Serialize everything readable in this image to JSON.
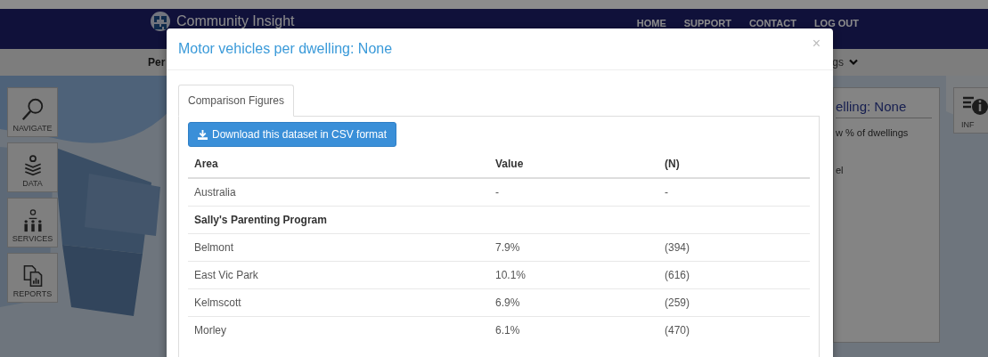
{
  "header": {
    "brand": "Community Insight",
    "nav": [
      "HOME",
      "SUPPORT",
      "CONTACT",
      "LOG OUT"
    ]
  },
  "subnav": {
    "left": "Per",
    "right": "gs"
  },
  "tools": [
    {
      "label": "NAVIGATE",
      "kind": "search"
    },
    {
      "label": "DATA",
      "kind": "layers"
    },
    {
      "label": "SERVICES",
      "kind": "people"
    },
    {
      "label": "REPORTS",
      "kind": "reports"
    }
  ],
  "side_panel": {
    "title": "elling: None",
    "lines": [
      "w % of dwellings",
      "el"
    ]
  },
  "info_button": {
    "label": "INF"
  },
  "modal": {
    "title": "Motor vehicles per dwelling: None",
    "close": "×",
    "tabs": [
      {
        "label": "Comparison Figures",
        "selected": true
      }
    ],
    "download": "Download this dataset in CSV format",
    "columns": [
      "Area",
      "Value",
      "(N)"
    ],
    "rows": [
      {
        "kind": "data",
        "cells": [
          "Australia",
          "-",
          "-"
        ]
      },
      {
        "kind": "group",
        "cells": [
          "Sally's Parenting Program"
        ]
      },
      {
        "kind": "data",
        "cells": [
          "Belmont",
          "7.9%",
          "(394)"
        ]
      },
      {
        "kind": "data",
        "cells": [
          "East Vic Park",
          "10.1%",
          "(616)"
        ]
      },
      {
        "kind": "data",
        "cells": [
          "Kelmscott",
          "6.9%",
          "(259)"
        ]
      },
      {
        "kind": "data",
        "cells": [
          "Morley",
          "6.1%",
          "(470)"
        ]
      }
    ]
  }
}
